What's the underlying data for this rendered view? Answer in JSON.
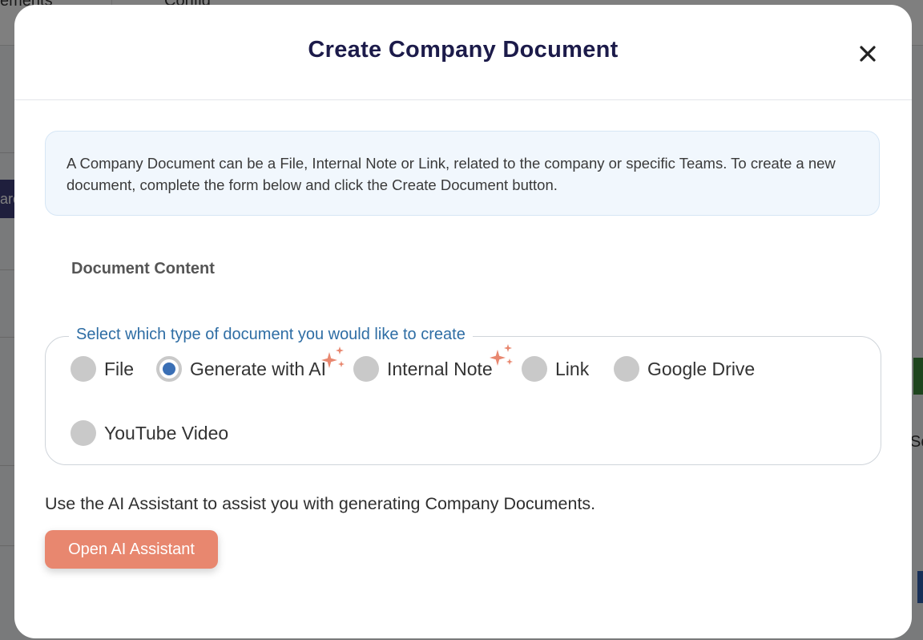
{
  "background": {
    "tabs": [
      "ements",
      "Config"
    ],
    "side_button_text": "arc",
    "edge_text": "So"
  },
  "modal": {
    "title": "Create Company Document",
    "close_icon": "close-icon",
    "info_text": "A Company Document can be a File, Internal Note or Link, related to the company or specific Teams. To create a new document, complete the form below and click the Create Document button.",
    "section_title": "Document Content",
    "type_selector": {
      "legend": "Select which type of document you would like to create",
      "options": [
        {
          "label": "File",
          "checked": false,
          "sparkle": false
        },
        {
          "label": "Generate with AI",
          "checked": true,
          "sparkle": true
        },
        {
          "label": "Internal Note",
          "checked": false,
          "sparkle": true
        },
        {
          "label": "Link",
          "checked": false,
          "sparkle": false
        },
        {
          "label": "Google Drive",
          "checked": false,
          "sparkle": false
        },
        {
          "label": "YouTube Video",
          "checked": false,
          "sparkle": false
        }
      ]
    },
    "ai_hint": "Use the AI Assistant to assist you with generating Company Documents.",
    "ai_button_label": "Open AI Assistant"
  },
  "colors": {
    "title": "#1c1b4a",
    "legend": "#2e6da4",
    "radio_checked": "#3a6fb5",
    "radio_unchecked": "#c9c9c9",
    "sparkle": "#e8876f",
    "ai_button": "#e8876f",
    "info_box_bg": "#f1f7fd"
  }
}
